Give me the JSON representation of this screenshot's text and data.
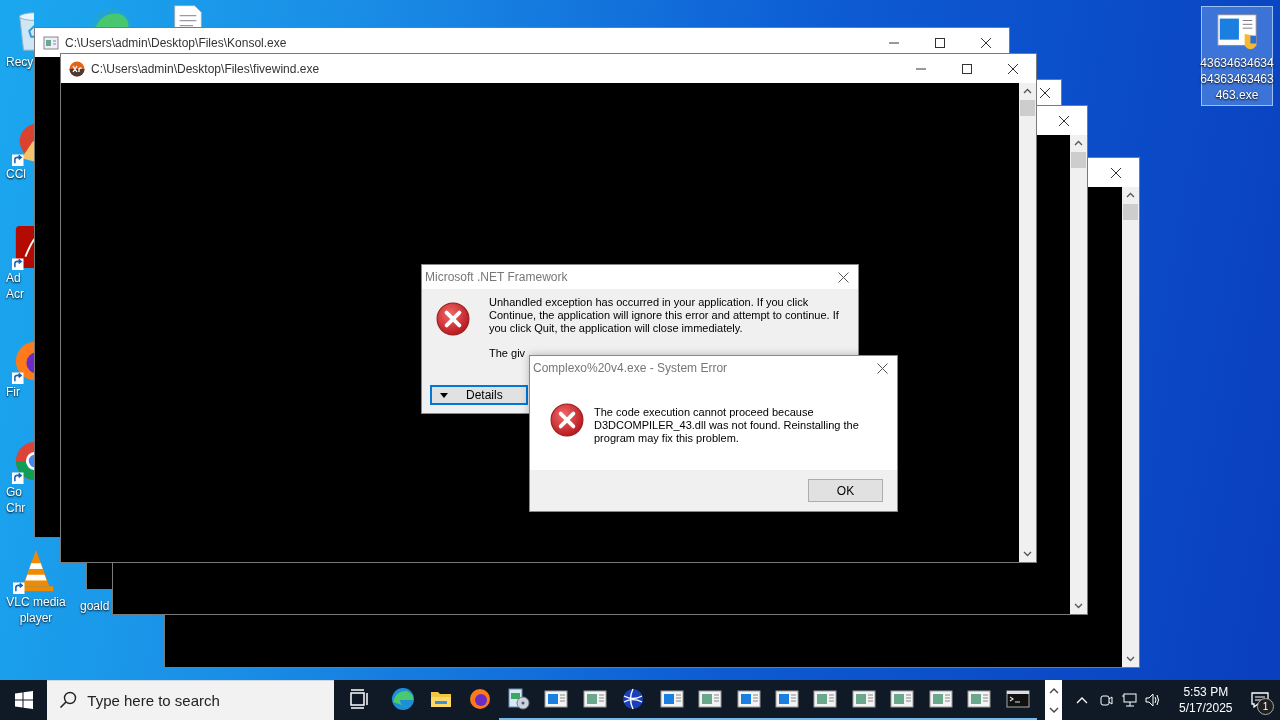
{
  "desktop": {
    "icons": [
      {
        "kind": "recycle-bin",
        "lines": [
          "Recy"
        ],
        "selected": false
      },
      {
        "kind": "edge",
        "selected": false
      },
      {
        "kind": "document",
        "selected": false
      },
      {
        "kind": "ccleaner",
        "lines": [
          "CCl"
        ],
        "selected": false
      },
      {
        "kind": "acrobat",
        "lines": [
          "Ad",
          "Acr"
        ],
        "selected": false
      },
      {
        "kind": "firefox",
        "lines": [
          "Fir"
        ],
        "selected": false
      },
      {
        "kind": "chrome",
        "lines": [
          "Go",
          "Chr"
        ],
        "selected": false
      },
      {
        "kind": "vlc",
        "lines": [
          "VLC media",
          "player"
        ],
        "selected": false
      },
      {
        "kind": "none",
        "lines": [
          "goald"
        ],
        "selected": false
      },
      {
        "kind": "program",
        "lines": [
          "43634634634",
          "64363463463",
          "463.exe"
        ],
        "selected": true
      }
    ]
  },
  "windows": [
    {
      "kind": "console"
    },
    {
      "kind": "console"
    },
    {
      "kind": "console"
    },
    {
      "kind": "console",
      "title": "C:\\Users\\admin\\Desktop\\Files\\Konsol.exe"
    },
    {
      "kind": "console",
      "title": "C:\\Users\\admin\\Desktop\\Files\\fivewind.exe"
    }
  ],
  "net_dialog": {
    "title": "Microsoft .NET Framework",
    "message": "Unhandled exception has occurred in your application. If you click Continue, the application will ignore this error and attempt to continue. If you click Quit, the application will close immediately.",
    "detail": "The giv",
    "buttons": [
      {
        "label": "Details",
        "focused": true
      }
    ]
  },
  "system_error": {
    "title": "Complexo%20v4.exe - System Error",
    "message": "The code execution cannot proceed because D3DCOMPILER_43.dll was not found. Reinstalling the program may fix this problem.",
    "buttons": [
      {
        "label": "OK",
        "focused": false
      }
    ]
  },
  "taskbar": {
    "search": {
      "placeholder": "Type here to search"
    },
    "apps": [
      {
        "kind": "taskview",
        "running": false
      },
      {
        "kind": "edge",
        "running": false
      },
      {
        "kind": "explorer",
        "running": false
      },
      {
        "kind": "firefox",
        "running": false
      },
      {
        "kind": "installer",
        "running": true
      },
      {
        "kind": "window-blue",
        "running": true
      },
      {
        "kind": "window-green",
        "running": true
      },
      {
        "kind": "globe",
        "running": true
      },
      {
        "kind": "window-blue",
        "running": true
      },
      {
        "kind": "window-green",
        "running": true
      },
      {
        "kind": "window-blue",
        "running": true
      },
      {
        "kind": "window-blue",
        "running": true
      },
      {
        "kind": "window-green",
        "running": true
      },
      {
        "kind": "window-green",
        "running": true
      },
      {
        "kind": "window-green",
        "running": true
      },
      {
        "kind": "window-green",
        "running": true
      },
      {
        "kind": "window-green",
        "running": true
      },
      {
        "kind": "cmd",
        "running": true
      }
    ],
    "clock": {
      "time": "5:53 PM",
      "date": "5/17/2025"
    },
    "notification_count": "1"
  }
}
